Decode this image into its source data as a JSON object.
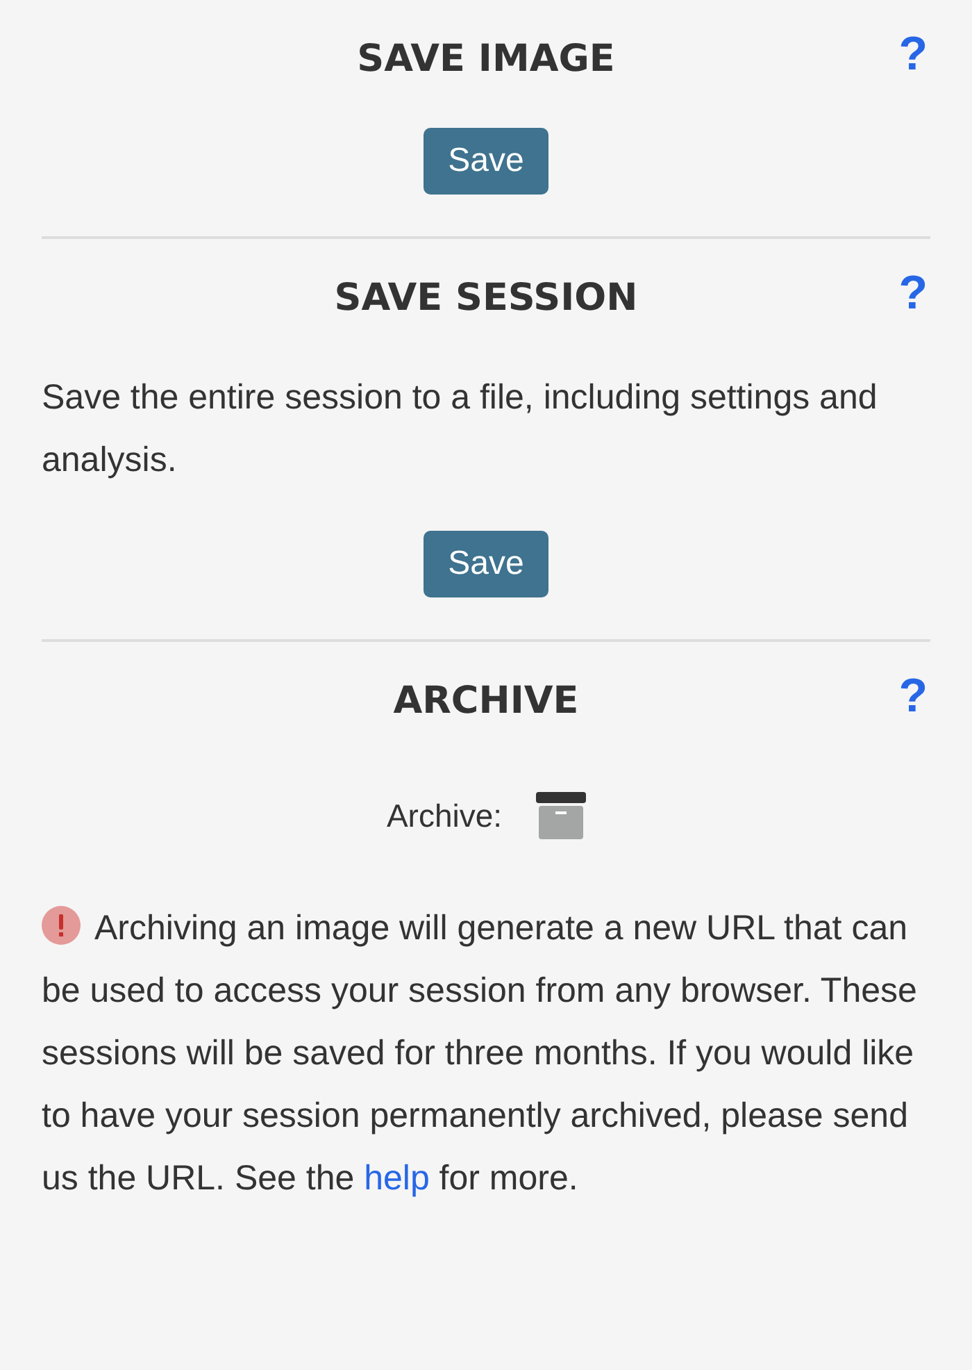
{
  "sections": [
    {
      "title": "SAVE IMAGE",
      "help": "?",
      "kind": "button",
      "button": "Save"
    },
    {
      "title": "SAVE SESSION",
      "help": "?",
      "kind": "text_button",
      "text": "Save the entire session to a file, including settings and analysis.",
      "button": "Save"
    },
    {
      "title": "ARCHIVE",
      "help": "?",
      "kind": "archive",
      "label": "Archive:",
      "note_before": "Archiving an image will generate a new URL that can be used to access your session from any browser. These sessions will be saved for three months. If you would like to have your session permanently archived, please send us the URL. See the ",
      "link": "help",
      "note_after": " for more."
    }
  ]
}
